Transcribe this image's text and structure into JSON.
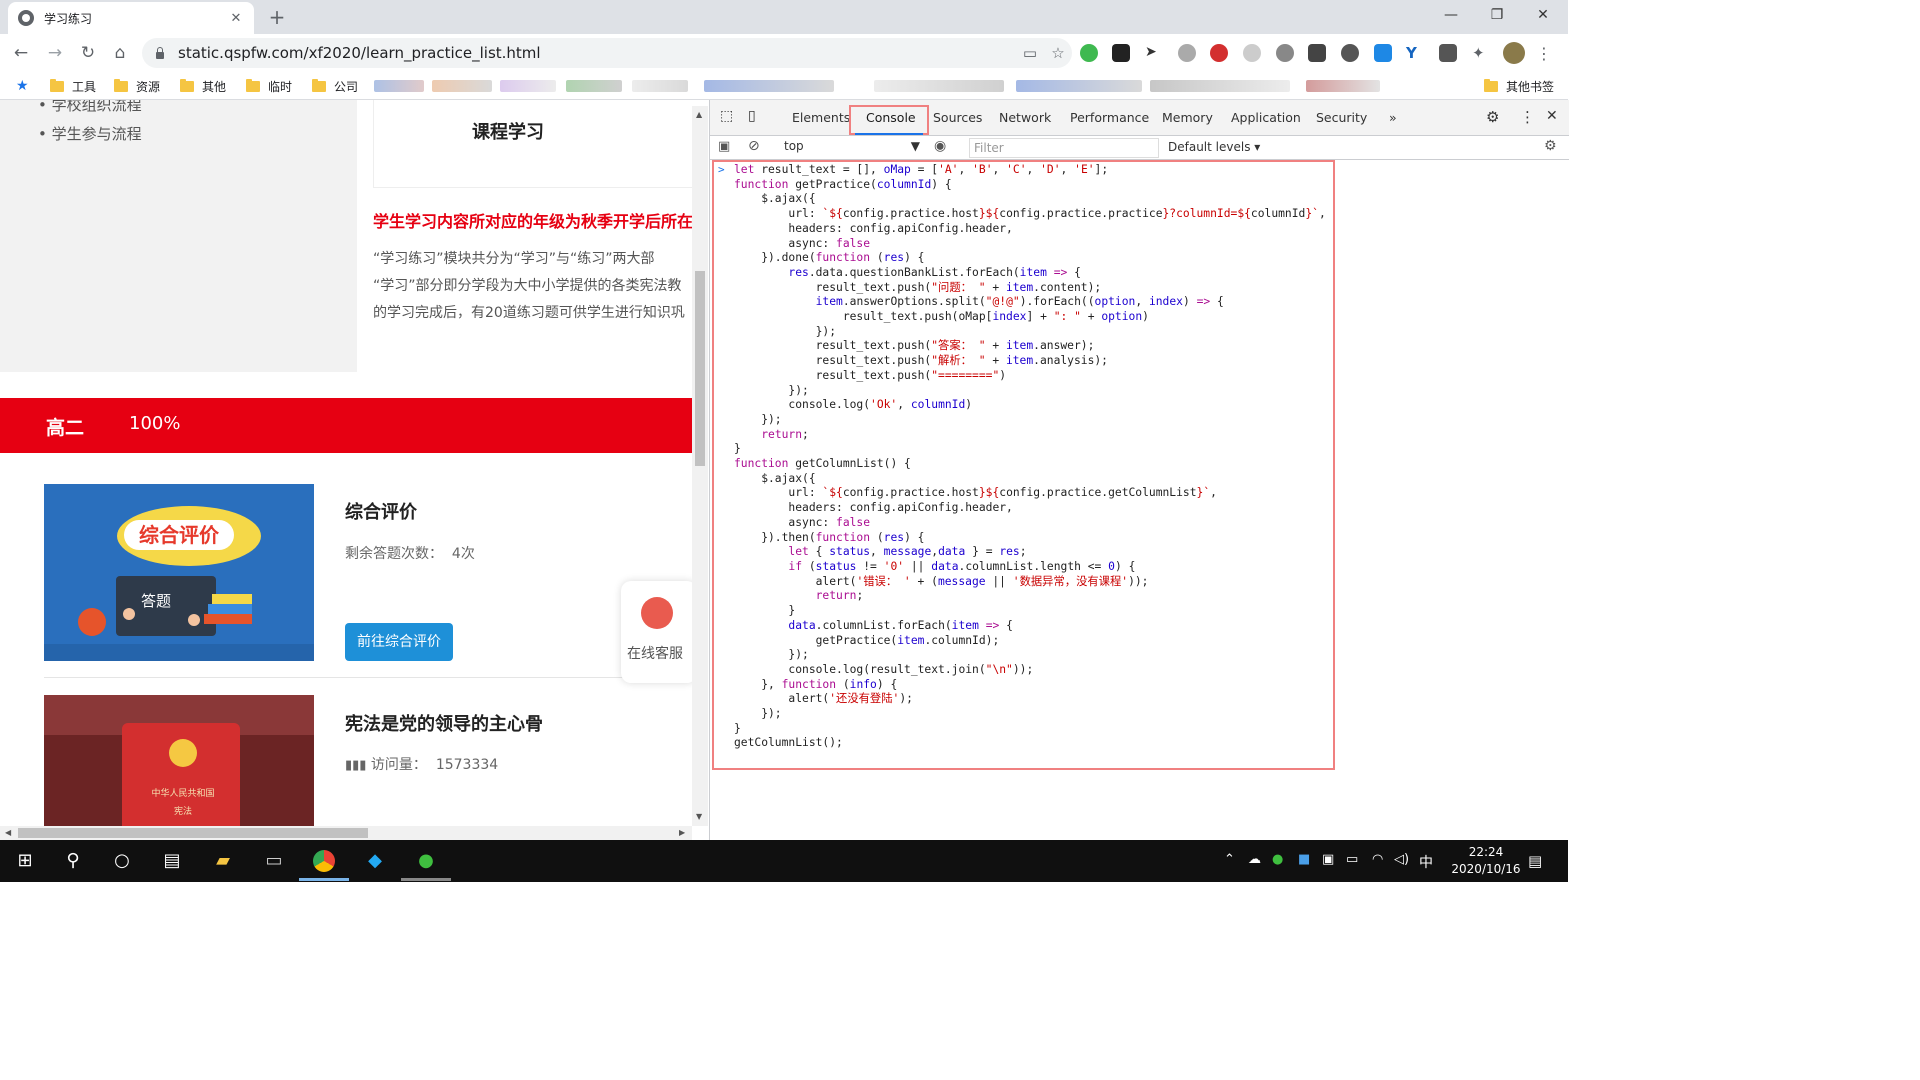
{
  "browser": {
    "tab_title": "学习练习",
    "url": "static.qspfw.com/xf2020/learn_practice_list.html",
    "bookmarks": [
      "工具",
      "资源",
      "其他",
      "临时",
      "公司"
    ],
    "other_bookmarks": "其他书签"
  },
  "page": {
    "sidebar_partial": "学校组织流程",
    "sidebar_item": "学生参与流程",
    "course_title": "课程学习",
    "red_heading": "学生学习内容所对应的年级为秋季开学后所在",
    "para_lines": [
      "“学习练习”模块共分为“学习”与“练习”两大部",
      "“学习”部分即分学段为大中小学提供的各类宪法教",
      "的学习完成后，有20道练习题可供学生进行知识巩"
    ],
    "grade": "高二",
    "percent": "100%",
    "items": [
      {
        "title": "综合评价",
        "sub_label": "剩余答题次数：",
        "sub_value": "4次",
        "button": "前往综合评价",
        "thumb_title": "综合评价",
        "thumb_sub": "答题"
      },
      {
        "title": "宪法是党的领导的主心骨",
        "sub_label": "访问量：",
        "sub_value": "1573334",
        "thumb_text1": "中华人民共和国",
        "thumb_text2": "宪法"
      }
    ],
    "customer_service": "在线客服"
  },
  "devtools": {
    "tabs": [
      "Elements",
      "Console",
      "Sources",
      "Network",
      "Performance",
      "Memory",
      "Application",
      "Security",
      "»"
    ],
    "active_tab": "Console",
    "context": "top",
    "filter_placeholder": "Filter",
    "levels": "Default levels ▾"
  },
  "taskbar": {
    "time": "22:24",
    "date": "2020/10/16",
    "ime": "中"
  }
}
